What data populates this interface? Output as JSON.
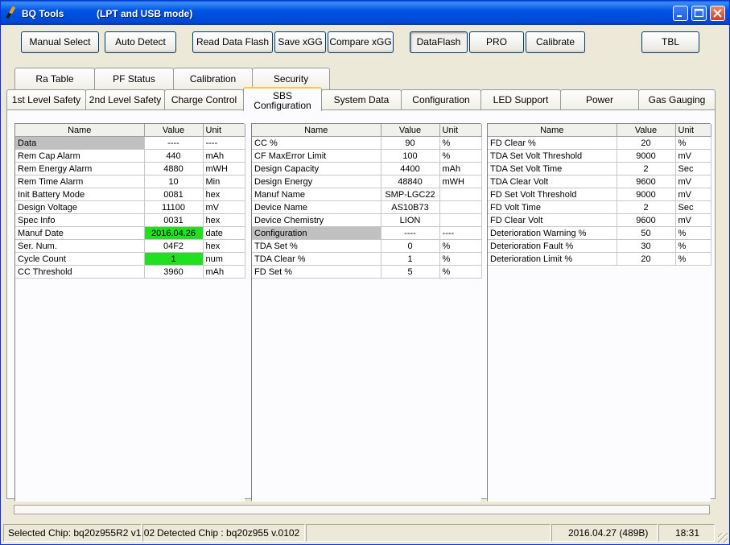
{
  "window": {
    "title": "BQ Tools",
    "mode": "(LPT and USB mode)"
  },
  "toolbar": {
    "manual_select": "Manual Select",
    "auto_detect": "Auto Detect",
    "read_data_flash": "Read Data Flash",
    "save_xgg": "Save xGG",
    "compare_xgg": "Compare xGG",
    "dataflash": "DataFlash",
    "pro": "PRO",
    "calibrate": "Calibrate",
    "tbl": "TBL"
  },
  "tabs_row1": [
    "Ra Table",
    "PF Status",
    "Calibration",
    "Security"
  ],
  "tabs_row2": [
    "1st Level Safety",
    "2nd Level Safety",
    "Charge Control",
    "SBS Configuration",
    "System Data",
    "Configuration",
    "LED Support",
    "Power",
    "Gas Gauging"
  ],
  "active_tab": {
    "line1": "SBS",
    "line2": "Configuration"
  },
  "columns": {
    "name": "Name",
    "value": "Value",
    "unit": "Unit"
  },
  "table1": [
    {
      "name": "Data",
      "value": "----",
      "unit": "----",
      "style": "sel"
    },
    {
      "name": "Rem Cap Alarm",
      "value": "440",
      "unit": "mAh"
    },
    {
      "name": "Rem Energy Alarm",
      "value": "4880",
      "unit": "mWH"
    },
    {
      "name": "Rem Time Alarm",
      "value": "10",
      "unit": "Min"
    },
    {
      "name": "Init Battery Mode",
      "value": "0081",
      "unit": "hex"
    },
    {
      "name": "Design Voltage",
      "value": "11100",
      "unit": "mV"
    },
    {
      "name": "Spec Info",
      "value": "0031",
      "unit": "hex"
    },
    {
      "name": "Manuf Date",
      "value": "2016.04.26",
      "unit": "date",
      "valstyle": "green"
    },
    {
      "name": "Ser. Num.",
      "value": "04F2",
      "unit": "hex"
    },
    {
      "name": "Cycle Count",
      "value": "1",
      "unit": "num",
      "valstyle": "green"
    },
    {
      "name": "CC Threshold",
      "value": "3960",
      "unit": "mAh"
    }
  ],
  "table2": [
    {
      "name": "CC %",
      "value": "90",
      "unit": "%"
    },
    {
      "name": "CF MaxError Limit",
      "value": "100",
      "unit": "%"
    },
    {
      "name": "Design Capacity",
      "value": "4400",
      "unit": "mAh"
    },
    {
      "name": "Design Energy",
      "value": "48840",
      "unit": "mWH"
    },
    {
      "name": "Manuf Name",
      "value": "SMP-LGC22",
      "unit": ""
    },
    {
      "name": "Device Name",
      "value": "AS10B73",
      "unit": ""
    },
    {
      "name": "Device Chemistry",
      "value": "LION",
      "unit": ""
    },
    {
      "name": "Configuration",
      "value": "----",
      "unit": "----",
      "style": "sel"
    },
    {
      "name": "TDA Set %",
      "value": "0",
      "unit": "%"
    },
    {
      "name": "TDA Clear %",
      "value": "1",
      "unit": "%"
    },
    {
      "name": "FD Set %",
      "value": "5",
      "unit": "%"
    }
  ],
  "table3": [
    {
      "name": "FD Clear %",
      "value": "20",
      "unit": "%"
    },
    {
      "name": "TDA Set Volt Threshold",
      "value": "9000",
      "unit": "mV"
    },
    {
      "name": "TDA Set Volt Time",
      "value": "2",
      "unit": "Sec"
    },
    {
      "name": "TDA Clear Volt",
      "value": "9600",
      "unit": "mV"
    },
    {
      "name": "FD Set Volt Threshold",
      "value": "9000",
      "unit": "mV"
    },
    {
      "name": "FD Volt Time",
      "value": "2",
      "unit": "Sec"
    },
    {
      "name": "FD Clear Volt",
      "value": "9600",
      "unit": "mV"
    },
    {
      "name": "Deterioration Warning %",
      "value": "50",
      "unit": "%"
    },
    {
      "name": "Deterioration Fault %",
      "value": "30",
      "unit": "%"
    },
    {
      "name": "Deterioration Limit %",
      "value": "20",
      "unit": "%"
    }
  ],
  "status": {
    "selected_chip": "Selected Chip: bq20z955R2 v1.02",
    "detected_chip": "Detected Chip : bq20z955  v.0102",
    "date": "2016.04.27  (489B)",
    "time": "18:31"
  },
  "colors": {
    "title_bar": "#0055e5",
    "highlight_green": "#20e020",
    "selected_row": "#c0c0c0",
    "active_tab_accent": "#ffc83c"
  }
}
